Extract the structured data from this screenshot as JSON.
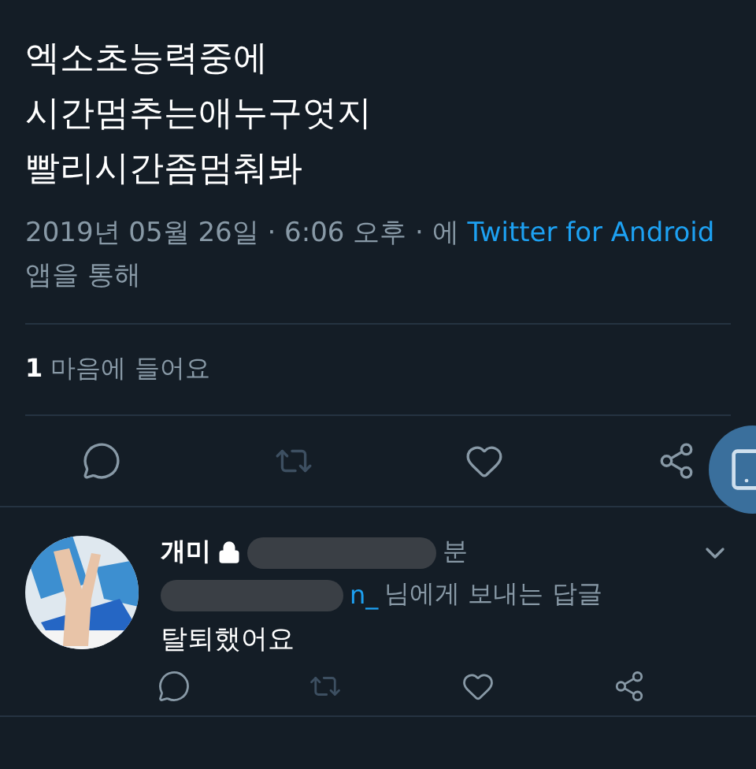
{
  "tweet": {
    "text_lines": [
      "엑소초능력중에",
      "시간멈추는애누구엿지",
      "빨리시간좀멈춰봐"
    ],
    "timestamp": "2019년 05월 26일 · 6:06 오후 · 에",
    "source": "Twitter for Android",
    "source_suffix": "앱을 통해",
    "like_count": "1",
    "like_label": "마음에 들어요",
    "actions": [
      {
        "kind": "reply",
        "disabled": false
      },
      {
        "kind": "retweet",
        "disabled": true
      },
      {
        "kind": "like",
        "disabled": false
      },
      {
        "kind": "share",
        "disabled": false
      }
    ]
  },
  "reply": {
    "name": "개미",
    "protected": true,
    "time": "분",
    "handle_tail": "n_",
    "reply_to_label": "님에게 보내는 답글",
    "text": "탈퇴했어요",
    "actions": [
      {
        "kind": "reply",
        "disabled": false
      },
      {
        "kind": "retweet",
        "disabled": true
      },
      {
        "kind": "like",
        "disabled": false
      },
      {
        "kind": "share",
        "disabled": false
      }
    ]
  }
}
